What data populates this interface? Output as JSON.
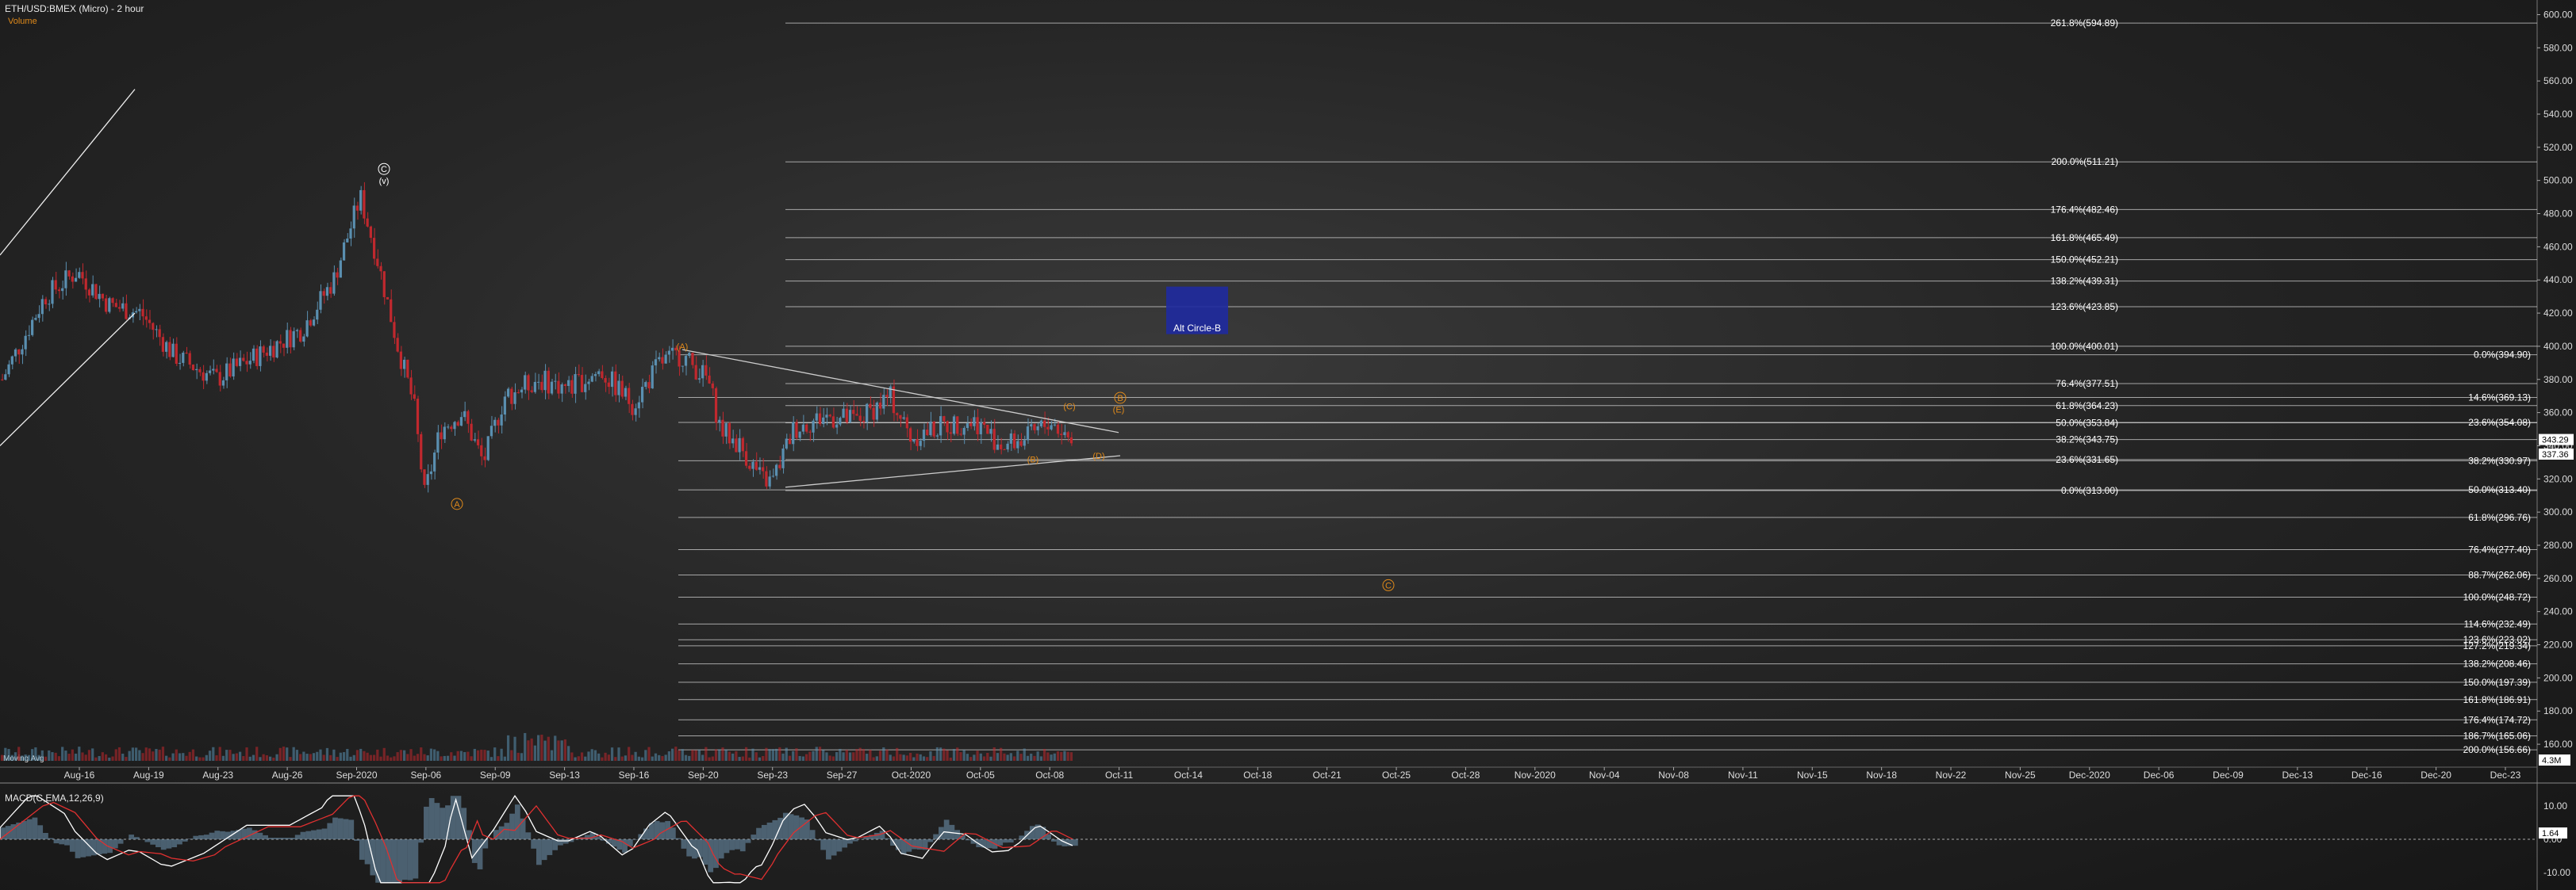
{
  "header": {
    "title": "ETH/USD:BMEX (Micro) - 2 hour",
    "subtitle": "Volume"
  },
  "volume_label": "Moving Avg",
  "macd_title": "MACD(C,EMA,12,26,9)",
  "colors": {
    "up": "#5a8fb0",
    "down": "#c0282e",
    "wave": "#e08a1a",
    "fib": "#dcdcdc",
    "box": "#1f2aa0"
  },
  "chart_data": [
    {
      "type": "candlestick",
      "title": "ETH/USD:BMEX (Micro) - 2 hour",
      "yaxis_ticks": [
        160,
        180,
        200,
        220,
        240,
        260,
        280,
        300,
        320,
        340,
        360,
        380,
        400,
        420,
        440,
        460,
        480,
        500,
        520,
        540,
        560,
        580,
        600
      ],
      "ylim": [
        150,
        605
      ],
      "x_tick_labels": [
        "Aug-16",
        "Aug-19",
        "Aug-23",
        "Aug-26",
        "Sep-2020",
        "Sep-06",
        "Sep-09",
        "Sep-13",
        "Sep-16",
        "Sep-20",
        "Sep-23",
        "Sep-27",
        "Oct-2020",
        "Oct-05",
        "Oct-08",
        "Oct-11",
        "Oct-14",
        "Oct-18",
        "Oct-21",
        "Oct-25",
        "Oct-28",
        "Nov-2020",
        "Nov-04",
        "Nov-08",
        "Nov-11",
        "Nov-15",
        "Nov-18",
        "Nov-22",
        "Nov-25",
        "Dec-2020",
        "Dec-06",
        "Dec-09",
        "Dec-13",
        "Dec-16",
        "Dec-20",
        "Dec-23"
      ],
      "price_path": [
        [
          0,
          380
        ],
        [
          0.04,
          430
        ],
        [
          0.07,
          445
        ],
        [
          0.1,
          425
        ],
        [
          0.13,
          420
        ],
        [
          0.16,
          395
        ],
        [
          0.2,
          380
        ],
        [
          0.24,
          395
        ],
        [
          0.28,
          410
        ],
        [
          0.31,
          440
        ],
        [
          0.335,
          490
        ],
        [
          0.35,
          455
        ],
        [
          0.37,
          400
        ],
        [
          0.385,
          365
        ],
        [
          0.395,
          310
        ],
        [
          0.41,
          350
        ],
        [
          0.43,
          360
        ],
        [
          0.45,
          330
        ],
        [
          0.47,
          370
        ],
        [
          0.5,
          380
        ],
        [
          0.53,
          375
        ],
        [
          0.56,
          385
        ],
        [
          0.59,
          365
        ],
        [
          0.615,
          390
        ],
        [
          0.635,
          395
        ],
        [
          0.66,
          380
        ],
        [
          0.672,
          350
        ],
        [
          0.69,
          340
        ],
        [
          0.71,
          320
        ],
        [
          0.72,
          318
        ],
        [
          0.74,
          350
        ],
        [
          0.77,
          358
        ],
        [
          0.8,
          355
        ],
        [
          0.83,
          370
        ],
        [
          0.85,
          345
        ],
        [
          0.88,
          352
        ],
        [
          0.91,
          355
        ],
        [
          0.935,
          340
        ],
        [
          0.96,
          345
        ],
        [
          0.98,
          355
        ],
        [
          1.0,
          343.29
        ]
      ],
      "last_price": "343.29",
      "last_price_2": "337.36",
      "fib_lines_upper": [
        "261.8%(594.89)",
        "200.0%(511.21)",
        "176.4%(482.46)",
        "161.8%(465.49)",
        "150.0%(452.21)",
        "138.2%(439.31)",
        "123.6%(423.85)",
        "100.0%(400.01)",
        "76.4%(377.51)",
        "61.8%(364.23)",
        "50.0%(353.84)",
        "38.2%(343.75)",
        "23.6%(331.65)",
        "0.0%(313.00)"
      ],
      "fib_lines_right": [
        "0.0%(394.90)",
        "14.6%(369.13)",
        "23.6%(354.08)",
        "38.2%(330.97)",
        "50.0%(313.40)",
        "61.8%(296.76)",
        "76.4%(277.40)",
        "88.7%(262.06)",
        "100.0%(248.72)",
        "114.6%(232.49)",
        "123.6%(223.02)",
        "127.2%(219.34)",
        "138.2%(208.46)",
        "150.0%(197.39)",
        "161.8%(186.91)",
        "176.4%(174.72)",
        "186.7%(165.06)",
        "200.0%(156.66)"
      ],
      "wave_labels": [
        {
          "text": "(A)",
          "price": 398
        },
        {
          "text": "(B)",
          "price": 330
        },
        {
          "text": "(C)",
          "price": 362
        },
        {
          "text": "(D)",
          "price": 332
        },
        {
          "text": "(E)",
          "price": 360
        },
        {
          "text": "A",
          "price": 303
        },
        {
          "text": "B",
          "price": 367
        },
        {
          "text": "C",
          "price": 254
        },
        {
          "text": "(v)",
          "price": 498
        },
        {
          "text": "C",
          "price": 505
        }
      ],
      "box_label": "Alt Circle-B"
    },
    {
      "type": "macd",
      "title": "MACD(C,EMA,12,26,9)",
      "yaxis_ticks": [
        "10.00",
        "0.00",
        "-10.00"
      ],
      "ylim": [
        -14,
        14
      ],
      "last_value": "1.64"
    }
  ],
  "volume_last": "4.3M"
}
